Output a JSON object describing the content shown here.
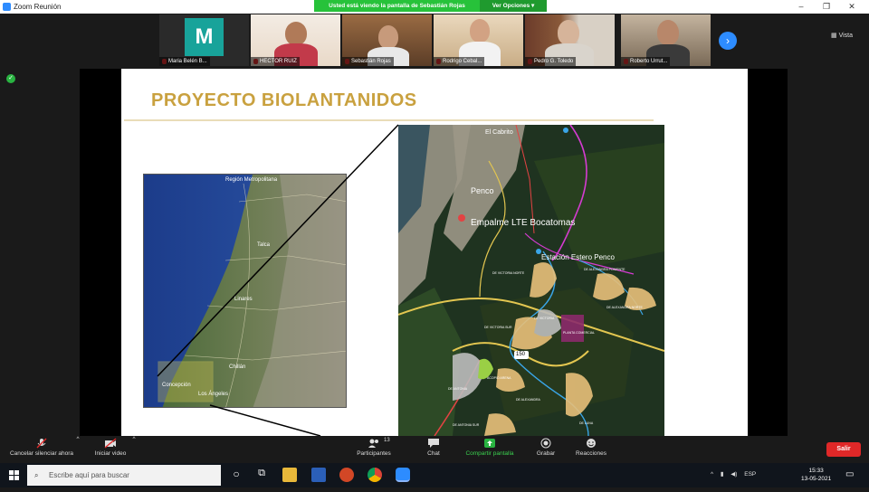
{
  "window": {
    "title": "Zoom Reunión",
    "share_banner": "Usted está viendo la pantalla de Sebastián Rojas",
    "view_options": "Ver Opciones ▾",
    "minimize": "–",
    "maximize": "❐",
    "close": "✕"
  },
  "gallery": {
    "participants": [
      {
        "name": "Maria Belén B...",
        "avatar_letter": "M"
      },
      {
        "name": "HECTOR RUIZ"
      },
      {
        "name": "Sebastián Rojas"
      },
      {
        "name": "Rodrigo Cebal..."
      },
      {
        "name": "Pedro G. Toledo"
      },
      {
        "name": "Roberto Urrut..."
      }
    ],
    "next_icon": "›",
    "view_label": "Vista"
  },
  "slide": {
    "title": "PROYECTO BIOLANTANIDOS",
    "chile_map_labels": [
      "Región Metropolitana",
      "Talca",
      "Linares",
      "Chillán",
      "Concepción",
      "Los Ángeles"
    ],
    "detail_map": {
      "labels": {
        "cabrito": "El Cabrito",
        "penco": "Penco",
        "empalme": "Empalme LTE Bocatomas",
        "estacion": "Estación Estero Penco",
        "route": "150"
      },
      "small_labels": [
        "DE VICTORIA NORTE",
        "DE ALEXANDRA PONIENTE",
        "DE ALEXANDRA NORTE",
        "DE VICTORIA SUR",
        "DE VICTORIA",
        "PLANTA COMERCIAL",
        "DE ANTONIA",
        "ACOPIO ARENA",
        "DE LUNA",
        "DE ALEXANDRA",
        "DE ANTONIA SUR"
      ]
    }
  },
  "controls": {
    "mute": "Cancelar silenciar ahora",
    "video": "Iniciar video",
    "participants": "Participantes",
    "participants_count": "13",
    "chat": "Chat",
    "share": "Compartir pantalla",
    "record": "Grabar",
    "reactions": "Reacciones",
    "leave": "Salir"
  },
  "taskbar": {
    "search_placeholder": "Escribe aquí para buscar",
    "language": "ESP",
    "time": "15:33",
    "date": "13-05-2021"
  }
}
